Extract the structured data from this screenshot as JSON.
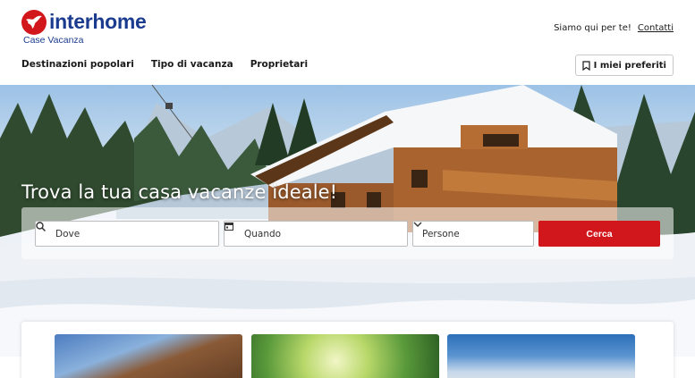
{
  "brand": {
    "name": "interhome",
    "tagline": "Case Vacanza",
    "color": "#d1161c",
    "text_color": "#1b3b8f"
  },
  "header": {
    "help_text": "Siamo qui per te!",
    "contact_link": "Contatti",
    "favorites_label": "I miei preferiti",
    "favorites_icon": "bookmark-icon"
  },
  "nav": {
    "items": [
      {
        "label": "Destinazioni popolari"
      },
      {
        "label": "Tipo di vacanza"
      },
      {
        "label": "Proprietari"
      }
    ]
  },
  "hero": {
    "title": "Trova la tua casa vacanze ideale!"
  },
  "search": {
    "where_placeholder": "Dove",
    "where_icon": "search-icon",
    "when_placeholder": "Quando",
    "when_icon": "calendar-icon",
    "people_label": "Persone",
    "people_icon": "chevron-down-icon",
    "submit_label": "Cerca",
    "submit_color": "#d1161c"
  }
}
